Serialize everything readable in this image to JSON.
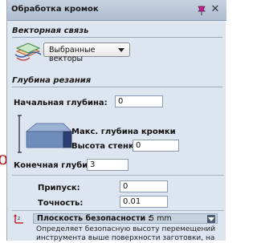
{
  "window": {
    "title": "Обработка кромок"
  },
  "icons": {
    "pin": "pin-icon",
    "close": "close-icon"
  },
  "vector_section": {
    "header": "Векторная связь",
    "dropdown_value": "Выбранные векторы"
  },
  "cut_depth_section": {
    "header": "Глубина резания",
    "start_depth_label": "Начальная глубина:",
    "start_depth_value": "0",
    "max_edge_depth_label": "Макс. глубина кромки",
    "wall_height_label": "Высота стенки:",
    "wall_height_value": "0",
    "end_depth_label": "Конечная глубина:",
    "end_depth_value": "3"
  },
  "tolerance": {
    "allowance_label": "Припуск:",
    "allowance_value": "0",
    "accuracy_label": "Точность:",
    "accuracy_value": "0.01"
  },
  "safety_plane": {
    "label": "Плоскость безопасности :",
    "value": "5 mm",
    "description": "Определяет безопасную высоту перемещений инструмента выше поверхности заготовки, на"
  },
  "colors": {
    "panel": "#dde5f0",
    "titlebar": "#b7c5d8",
    "accent_pin": "#c0208c"
  }
}
